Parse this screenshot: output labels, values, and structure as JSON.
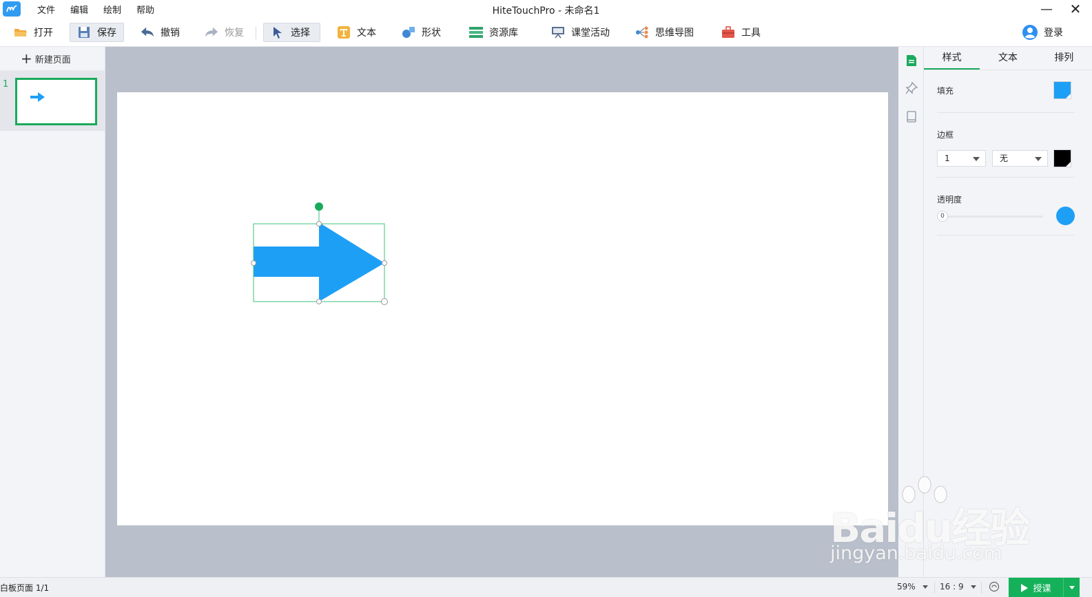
{
  "app": {
    "title": "HiteTouchPro - 未命名1",
    "logo_icon": "hite-logo-icon"
  },
  "menu": [
    {
      "label": "文件"
    },
    {
      "label": "编辑"
    },
    {
      "label": "绘制"
    },
    {
      "label": "帮助"
    }
  ],
  "window_controls": {
    "minimize": "—",
    "close": "✕"
  },
  "toolbar": {
    "open": "打开",
    "save": "保存",
    "undo": "撤销",
    "redo": "恢复",
    "select": "选择",
    "text": "文本",
    "shape": "形状",
    "resources": "资源库",
    "class_activity": "课堂活动",
    "mind_map": "思维导图",
    "tools": "工具",
    "login": "登录"
  },
  "pages_panel": {
    "new_page": "新建页面",
    "pages": [
      {
        "number": "1"
      }
    ]
  },
  "properties": {
    "tabs": [
      {
        "label": "样式",
        "active": true
      },
      {
        "label": "文本",
        "active": false
      },
      {
        "label": "排列",
        "active": false
      }
    ],
    "fill_label": "填充",
    "fill_color": "#1e9ff6",
    "border_label": "边框",
    "border_width": "1",
    "border_style": "无",
    "border_color": "#000000",
    "opacity_label": "透明度",
    "opacity_value": "0",
    "opacity_color": "#1e9ff6"
  },
  "canvas": {
    "selected_shape": "arrow-right",
    "shape_color": "#1e9ff6",
    "selection_color": "#1aaa5c"
  },
  "status": {
    "page": "白板页面 1/1",
    "zoom": "59%",
    "ratio": "16 : 9",
    "teach": "授课"
  },
  "watermark": {
    "brand": "Baidu经验",
    "url": "jingyan.baidu.com"
  }
}
